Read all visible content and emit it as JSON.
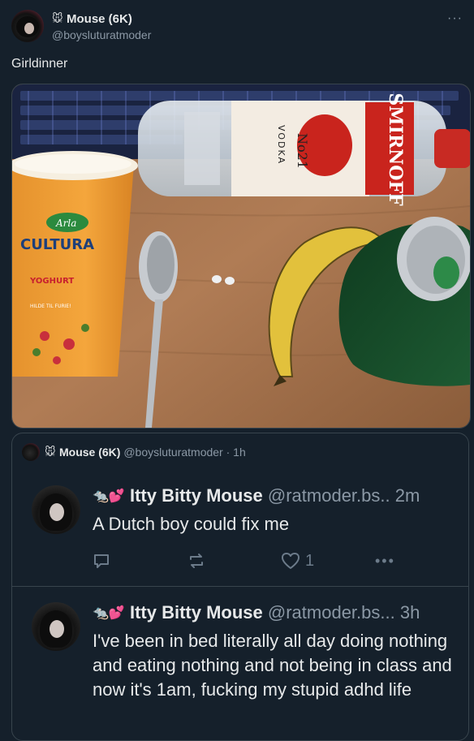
{
  "tweet": {
    "display_name": "Mouse (6K)",
    "handle": "@boysluturatmoder",
    "text": "Girldinner"
  },
  "media": {
    "description_labels": {
      "smirnoff": "SMIRNOFF",
      "no21": "No21",
      "vodka": "VODKA",
      "arla": "Arla",
      "cultura": "CULTURA",
      "yoghurt": "YOGHURT",
      "fresh": "HILDE TIL FURIE!"
    }
  },
  "quote": {
    "display_name": "Mouse (6K)",
    "handle": "@boysluturatmoder",
    "time": "· 1h"
  },
  "posts": [
    {
      "name": "Itty Bitty Mouse",
      "handle": "@ratmoder.bs..",
      "time": "2m",
      "text": "A Dutch boy could fix me",
      "likes": "1"
    },
    {
      "name": "Itty Bitty Mouse",
      "handle": "@ratmoder.bs...",
      "time": "3h",
      "text": "I've been in bed literally all day doing nothing and eating nothing and not being in class and now it's 1am, fucking my stupid adhd life"
    }
  ],
  "icons": [
    "mouse-icon",
    "more-icon",
    "reply-icon",
    "repost-icon",
    "like-icon",
    "menu-dots-icon",
    "hearts-icon"
  ]
}
